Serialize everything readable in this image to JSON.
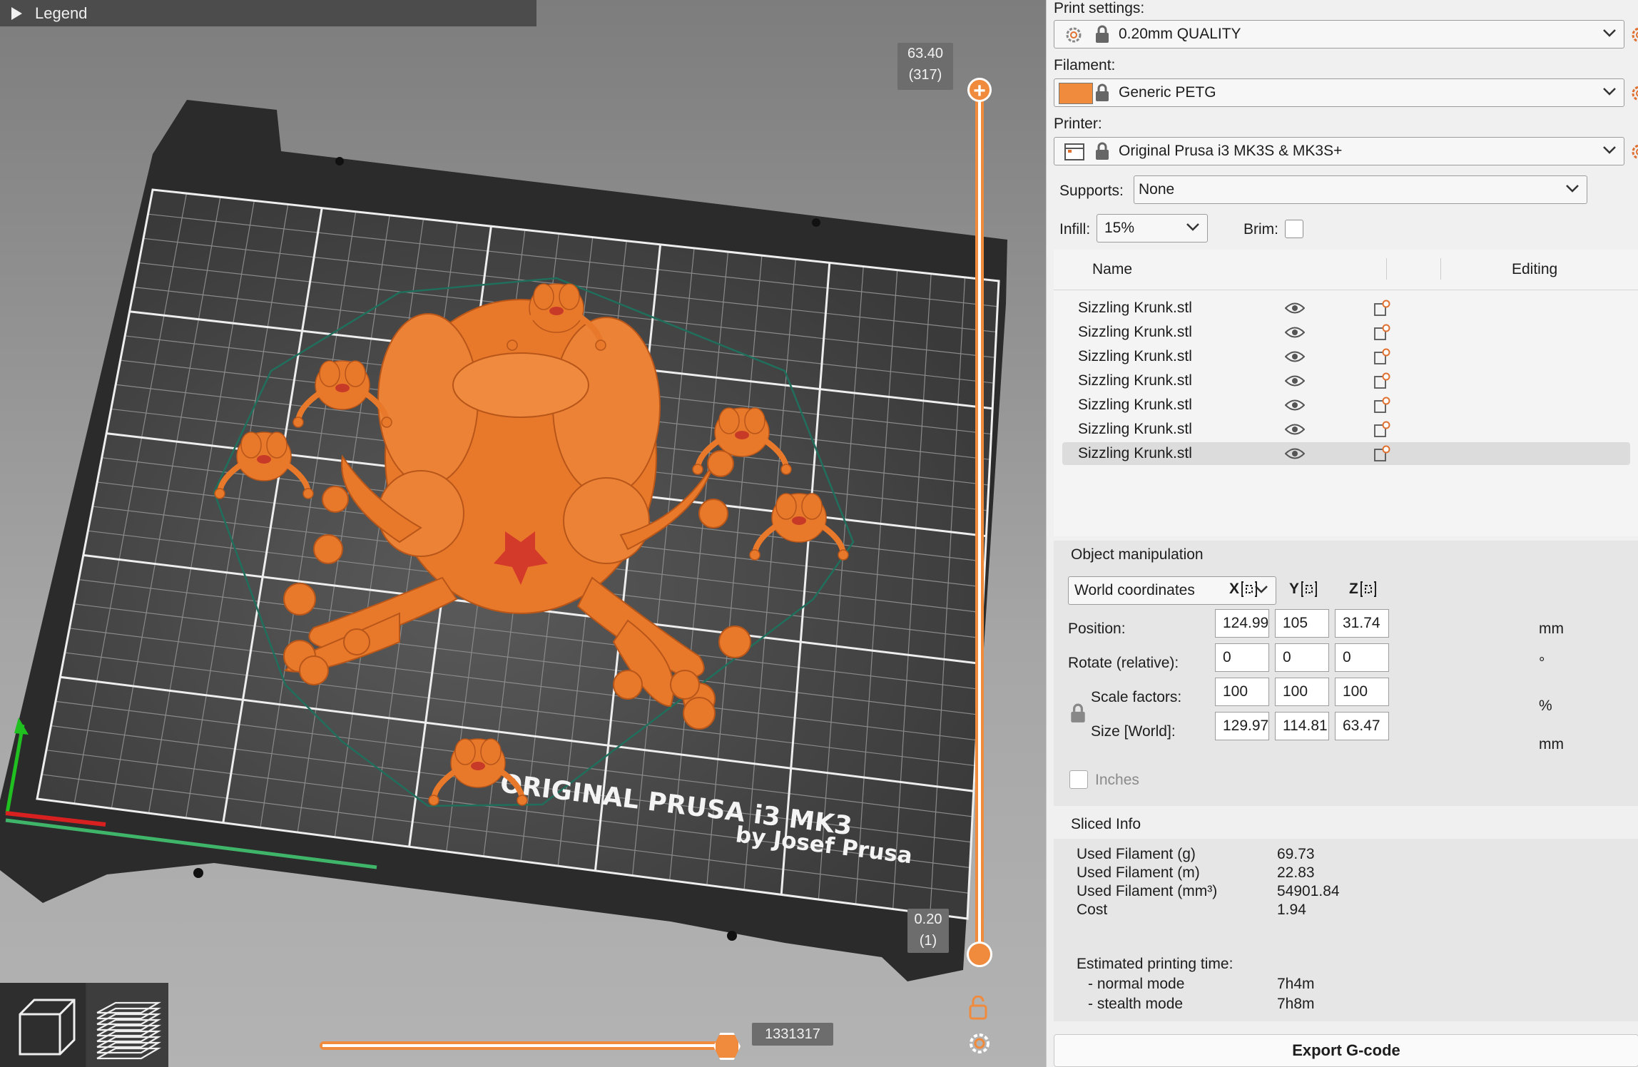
{
  "viewport": {
    "legend_label": "Legend",
    "bed_text_line1": "ORIGINAL PRUSA i3 MK3",
    "bed_text_line2": "by Josef Prusa",
    "top_height": "63.40",
    "top_layer": "(317)",
    "bottom_height": "0.20",
    "bottom_layer": "(1)",
    "move_count": "1331317",
    "view_modes": [
      "3d-view-icon",
      "layers-view-icon"
    ],
    "colors": {
      "model": "#e8782a",
      "accent": "#f08a3c",
      "bed": "#2a2a2a",
      "grid": "#ffffff"
    }
  },
  "settings": {
    "print_label": "Print settings:",
    "print_value": "0.20mm QUALITY",
    "filament_label": "Filament:",
    "filament_value": "Generic PETG",
    "filament_color": "#f08a3c",
    "printer_label": "Printer:",
    "printer_value": "Original Prusa i3 MK3S & MK3S+",
    "supports_label": "Supports:",
    "supports_value": "None",
    "infill_label": "Infill:",
    "infill_value": "15%",
    "brim_label": "Brim:",
    "brim_checked": false
  },
  "objects": {
    "col_name": "Name",
    "col_editing": "Editing",
    "rows": [
      "Sizzling Krunk.stl",
      "Sizzling Krunk.stl",
      "Sizzling Krunk.stl",
      "Sizzling Krunk.stl",
      "Sizzling Krunk.stl",
      "Sizzling Krunk.stl",
      "Sizzling Krunk.stl"
    ],
    "selected_index": 6
  },
  "manipulation": {
    "title": "Object manipulation",
    "coord_system": "World coordinates",
    "axes": [
      "X",
      "Y",
      "Z"
    ],
    "position_label": "Position:",
    "position": [
      "124.99",
      "105",
      "31.74"
    ],
    "position_unit": "mm",
    "rotate_label": "Rotate (relative):",
    "rotate": [
      "0",
      "0",
      "0"
    ],
    "rotate_unit": "°",
    "scale_label": "Scale factors:",
    "scale": [
      "100",
      "100",
      "100"
    ],
    "scale_unit": "%",
    "size_label": "Size [World]:",
    "size": [
      "129.97",
      "114.81",
      "63.47"
    ],
    "size_unit": "mm",
    "inches_label": "Inches"
  },
  "sliced_info": {
    "title": "Sliced Info",
    "rows": [
      {
        "key": "Used Filament (g)",
        "value": "69.73"
      },
      {
        "key": "Used Filament (m)",
        "value": "22.83"
      },
      {
        "key": "Used Filament (mm³)",
        "value": "54901.84"
      },
      {
        "key": "Cost",
        "value": "1.94"
      }
    ],
    "time_label": "Estimated printing time:",
    "normal_label": "- normal mode",
    "normal_value": "7h4m",
    "stealth_label": "- stealth mode",
    "stealth_value": "7h8m"
  },
  "export_label": "Export G-code"
}
